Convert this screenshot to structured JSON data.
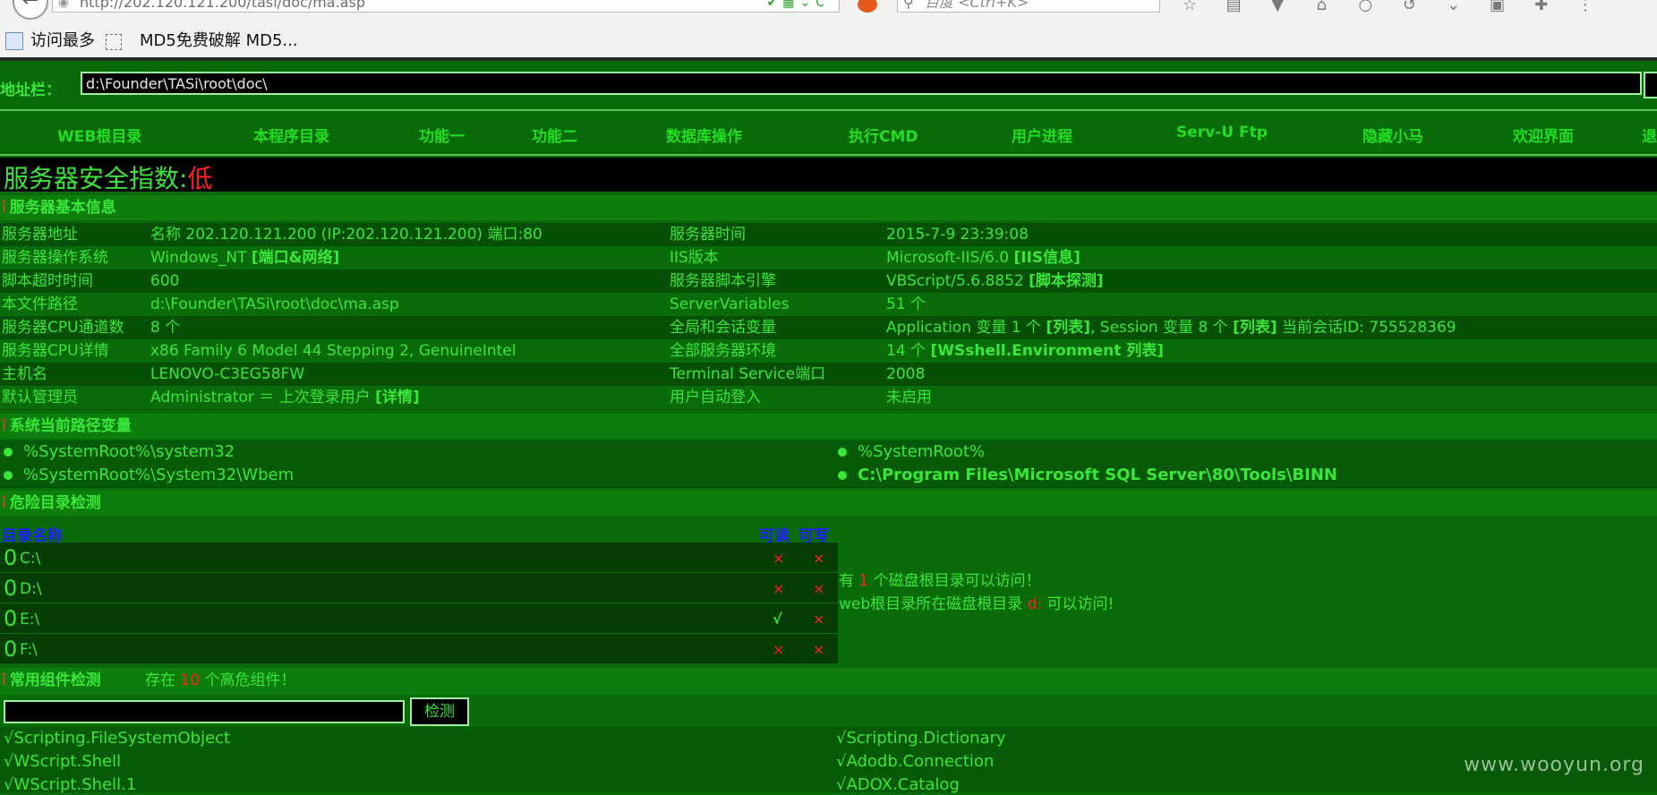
{
  "browser": {
    "url": "http://202.120.121.200/tasi/doc/ma.asp",
    "search_placeholder": "百度 <Ctrl+K>",
    "bookmarks": [
      {
        "label": "访问最多"
      },
      {
        "label": "MD5免费破解 MD5..."
      }
    ]
  },
  "addressbar": {
    "label": "地址栏：",
    "value": "d:\\Founder\\TASi\\root\\doc\\"
  },
  "nav": {
    "items": [
      "WEB根目录",
      "本程序目录",
      "功能一",
      "功能二",
      "数据库操作",
      "执行CMD",
      "用户进程",
      "Serv-U Ftp",
      "隐藏小马",
      "欢迎界面",
      "退"
    ]
  },
  "security": {
    "label": "服务器安全指数:",
    "value": "低"
  },
  "basic_info": {
    "title": "服务器基本信息",
    "mark": "î",
    "rows": [
      {
        "k1": "服务器地址",
        "v1": "名称 202.120.121.200 (IP:202.120.121.200) 端口:80",
        "l1": "",
        "k2": "服务器时间",
        "v2": "2015-7-9 23:39:08",
        "l2": ""
      },
      {
        "k1": "服务器操作系统",
        "v1": "Windows_NT ",
        "l1": "[端口&网络]",
        "k2": "IIS版本",
        "v2": "Microsoft-IIS/6.0 ",
        "l2": "[IIS信息]"
      },
      {
        "k1": "脚本超时时间",
        "v1": "600",
        "l1": "",
        "k2": "服务器脚本引擎",
        "v2": "VBScript/5.6.8852 ",
        "l2": "[脚本探测]"
      },
      {
        "k1": "本文件路径",
        "v1": "d:\\Founder\\TASi\\root\\doc\\ma.asp",
        "l1": "",
        "k2": "ServerVariables",
        "v2": "51 个",
        "l2": ""
      },
      {
        "k1": "服务器CPU通道数",
        "v1": "8 个",
        "l1": "",
        "k2": "全局和会话变量",
        "v2": "Application 变量 1 个 ",
        "l2": "[列表]",
        "v2b": ", Session 变量 8 个 ",
        "l2b": "[列表]",
        "v2c": " 当前会话ID: 755528369"
      },
      {
        "k1": "服务器CPU详情",
        "v1": "x86 Family 6 Model 44 Stepping 2, GenuineIntel",
        "l1": "",
        "k2": "全部服务器环境",
        "v2": "14 个 ",
        "l2": "[WSshell.Environment 列表]"
      },
      {
        "k1": "主机名",
        "v1": "LENOVO-C3EG58FW",
        "l1": "",
        "k2": "Terminal Service端口",
        "v2": "2008",
        "l2": ""
      },
      {
        "k1": "默认管理员",
        "v1": "Administrator ＝ 上次登录用户 ",
        "l1": "[详情]",
        "k2": "用户自动登入",
        "v2": "未启用",
        "l2": ""
      }
    ]
  },
  "path_vars": {
    "title": "系统当前路径变量",
    "items": [
      {
        "text": "%SystemRoot%\\system32",
        "bold": false
      },
      {
        "text": "%SystemRoot%",
        "bold": false
      },
      {
        "text": "%SystemRoot%\\System32\\Wbem",
        "bold": false
      },
      {
        "text": "C:\\Program Files\\Microsoft SQL Server\\80\\Tools\\BINN",
        "bold": true
      }
    ]
  },
  "danger_dirs": {
    "title": "危险目录检测",
    "col_name": "目录名称",
    "col_read": "可读",
    "col_write": "可写",
    "rows": [
      {
        "zero": "0",
        "name": "C:\\",
        "read": "×",
        "write": "×",
        "read_ok": false
      },
      {
        "zero": "0",
        "name": "D:\\",
        "read": "×",
        "write": "×",
        "read_ok": false
      },
      {
        "zero": "0",
        "name": "E:\\",
        "read": "√",
        "write": "×",
        "read_ok": true
      },
      {
        "zero": "0",
        "name": "F:\\",
        "read": "×",
        "write": "×",
        "read_ok": false
      }
    ],
    "result1_pre": "有 ",
    "result1_num": "1",
    "result1_post": " 个磁盘根目录可以访问！",
    "result2_pre": "web根目录所在磁盘根目录 ",
    "result2_drive": "d:",
    "result2_post": " 可以访问!"
  },
  "components": {
    "title": "常用组件检测",
    "summary_pre": "存在 ",
    "summary_num": "10",
    "summary_post": " 个高危组件！",
    "button": "检测",
    "items": [
      "√Scripting.FileSystemObject",
      "√Scripting.Dictionary",
      "√WScript.Shell",
      "√Adodb.Connection",
      "√WScript.Shell.1",
      "√ADOX.Catalog"
    ]
  },
  "watermark": "www.wooyun.org"
}
